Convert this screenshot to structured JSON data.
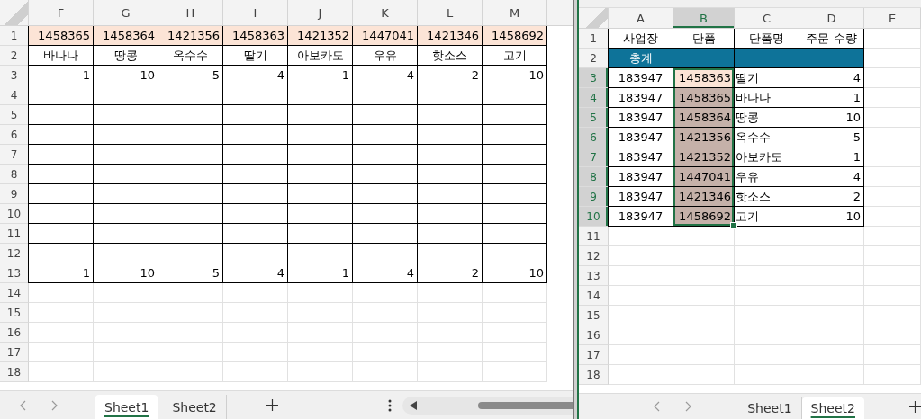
{
  "left_window": {
    "columns": [
      {
        "label": "F",
        "selected": false
      },
      {
        "label": "G",
        "selected": false
      },
      {
        "label": "H",
        "selected": false
      },
      {
        "label": "I",
        "selected": false
      },
      {
        "label": "J",
        "selected": false
      },
      {
        "label": "K",
        "selected": false
      },
      {
        "label": "L",
        "selected": false
      },
      {
        "label": "M",
        "selected": false
      }
    ],
    "rows": [
      {
        "number": "1",
        "kind": "codes",
        "cells": [
          "1458365",
          "1458364",
          "1421356",
          "1458363",
          "1421352",
          "1447041",
          "1421346",
          "1458692"
        ]
      },
      {
        "number": "2",
        "kind": "names",
        "cells": [
          "바나나",
          "땅콩",
          "옥수수",
          "딸기",
          "아보카도",
          "우유",
          "핫소스",
          "고기"
        ]
      },
      {
        "number": "3",
        "kind": "numbers",
        "cells": [
          "1",
          "10",
          "5",
          "4",
          "1",
          "4",
          "2",
          "10"
        ]
      },
      {
        "number": "4",
        "kind": "blank"
      },
      {
        "number": "5",
        "kind": "blank"
      },
      {
        "number": "6",
        "kind": "blank"
      },
      {
        "number": "7",
        "kind": "blank"
      },
      {
        "number": "8",
        "kind": "blank"
      },
      {
        "number": "9",
        "kind": "blank"
      },
      {
        "number": "10",
        "kind": "blank"
      },
      {
        "number": "11",
        "kind": "blank"
      },
      {
        "number": "12",
        "kind": "blank"
      },
      {
        "number": "13",
        "kind": "numbers",
        "cells": [
          "1",
          "10",
          "5",
          "4",
          "1",
          "4",
          "2",
          "10"
        ]
      },
      {
        "number": "14",
        "kind": "plain"
      },
      {
        "number": "15",
        "kind": "plain"
      },
      {
        "number": "16",
        "kind": "plain"
      },
      {
        "number": "17",
        "kind": "plain"
      },
      {
        "number": "18",
        "kind": "plain"
      }
    ],
    "tabs": [
      {
        "label": "Sheet1",
        "selected": true
      },
      {
        "label": "Sheet2",
        "selected": false
      }
    ]
  },
  "right_window": {
    "columns": [
      {
        "label": "A",
        "selected": false
      },
      {
        "label": "B",
        "selected": true
      },
      {
        "label": "C",
        "selected": false
      },
      {
        "label": "D",
        "selected": false
      },
      {
        "label": "E",
        "selected": false
      }
    ],
    "rows": [
      {
        "number": "1",
        "kind": "header",
        "selected": false,
        "cells": [
          "사업장",
          "단품",
          "단품명",
          "주문 수량"
        ]
      },
      {
        "number": "2",
        "kind": "total",
        "selected": false,
        "cells": [
          "총계"
        ]
      },
      {
        "number": "3",
        "kind": "record",
        "selected": true,
        "active": true,
        "cells": [
          "183947",
          "1458363",
          "딸기",
          "4"
        ]
      },
      {
        "number": "4",
        "kind": "record",
        "selected": true,
        "active": false,
        "cells": [
          "183947",
          "1458365",
          "바나나",
          "1"
        ]
      },
      {
        "number": "5",
        "kind": "record",
        "selected": true,
        "active": false,
        "cells": [
          "183947",
          "1458364",
          "땅콩",
          "10"
        ]
      },
      {
        "number": "6",
        "kind": "record",
        "selected": true,
        "active": false,
        "cells": [
          "183947",
          "1421356",
          "옥수수",
          "5"
        ]
      },
      {
        "number": "7",
        "kind": "record",
        "selected": true,
        "active": false,
        "cells": [
          "183947",
          "1421352",
          "아보카도",
          "1"
        ]
      },
      {
        "number": "8",
        "kind": "record",
        "selected": true,
        "active": false,
        "cells": [
          "183947",
          "1447041",
          "우유",
          "4"
        ]
      },
      {
        "number": "9",
        "kind": "record",
        "selected": true,
        "active": false,
        "cells": [
          "183947",
          "1421346",
          "핫소스",
          "2"
        ]
      },
      {
        "number": "10",
        "kind": "record",
        "selected": true,
        "active": false,
        "cells": [
          "183947",
          "1458692",
          "고기",
          "10"
        ]
      },
      {
        "number": "11",
        "kind": "plain",
        "selected": false
      },
      {
        "number": "12",
        "kind": "plain",
        "selected": false
      },
      {
        "number": "13",
        "kind": "plain",
        "selected": false
      },
      {
        "number": "14",
        "kind": "plain",
        "selected": false
      },
      {
        "number": "15",
        "kind": "plain",
        "selected": false
      },
      {
        "number": "16",
        "kind": "plain",
        "selected": false
      },
      {
        "number": "17",
        "kind": "plain",
        "selected": false
      },
      {
        "number": "18",
        "kind": "plain",
        "selected": false
      }
    ],
    "tabs": [
      {
        "label": "Sheet1",
        "selected": false
      },
      {
        "label": "Sheet2",
        "selected": true
      }
    ]
  }
}
